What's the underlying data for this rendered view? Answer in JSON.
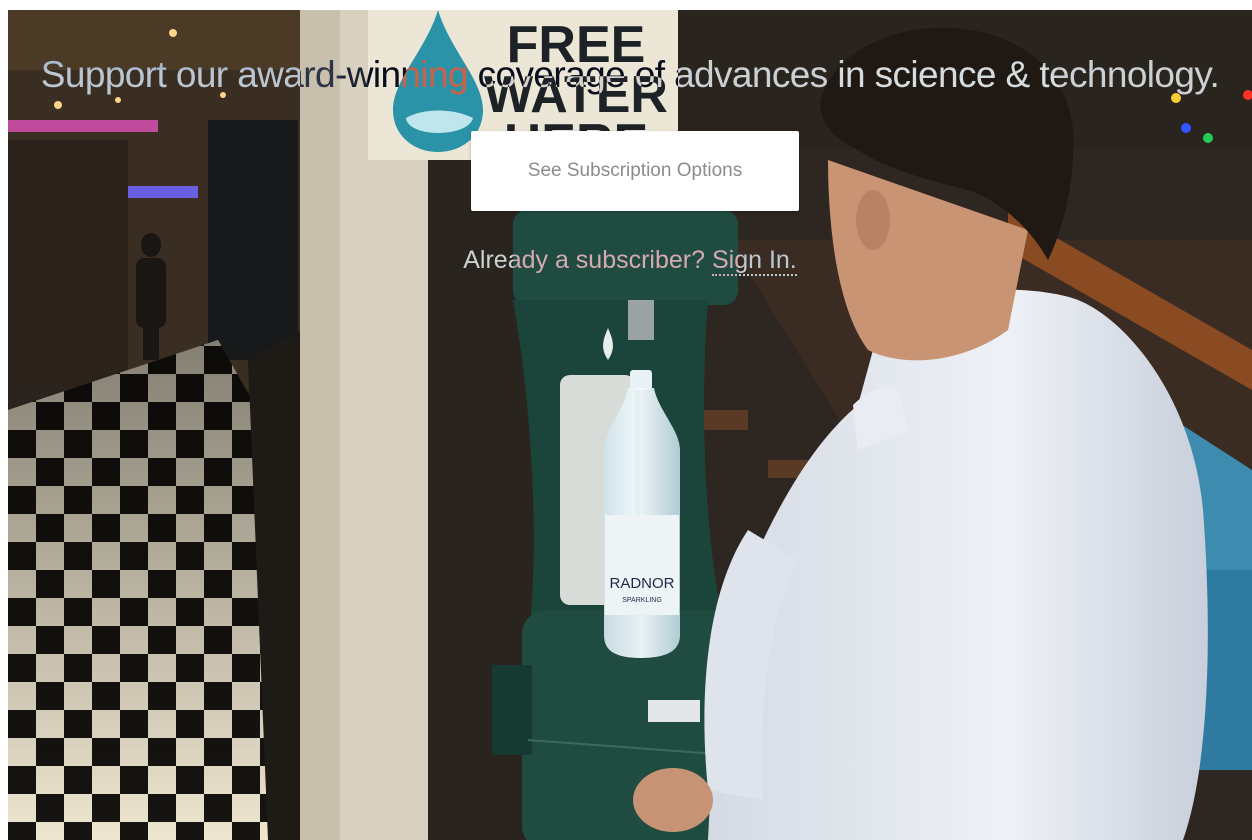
{
  "hero": {
    "image_alt": "Man filling a plastic bottle at a green water refill station in a shopping arcade",
    "sign_text_line1": "FREE",
    "sign_text_line2": "WATER",
    "sign_text_line3": "HERE",
    "bottle_brand": "RADNOR",
    "bottle_variant": "SPARKLING",
    "colors": {
      "fountain": "#1e4a40",
      "sign_drop": "#2a93a8",
      "shirt": "#e8ecf2",
      "pillar": "#ddd6c6"
    }
  },
  "paywall": {
    "headline": "Support our award-winning coverage of advances in science & technology.",
    "cta_label": "See Subscription Options",
    "already_prefix": "Already a subscriber? ",
    "sign_in_label": "Sign In."
  }
}
